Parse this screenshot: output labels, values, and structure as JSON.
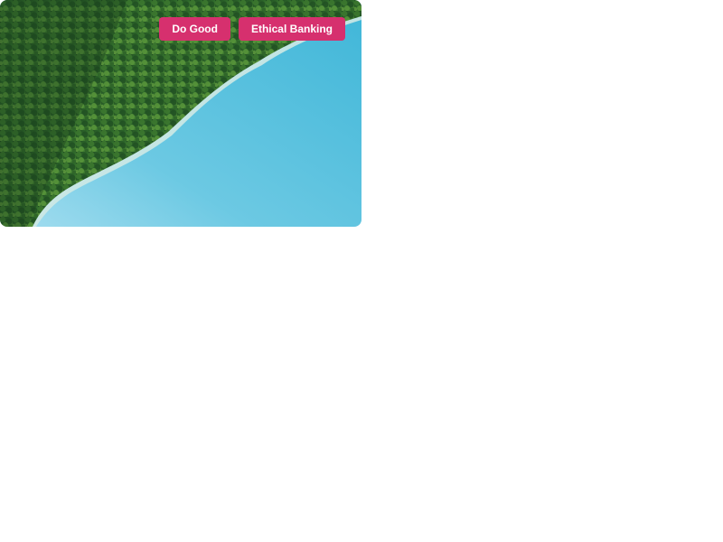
{
  "card": {
    "image_alt_subject": "forest-lake-aerial-photo",
    "tags": [
      {
        "label": "Do Good"
      },
      {
        "label": "Ethical Banking"
      }
    ]
  },
  "colors": {
    "tag_background": "#d6306e",
    "tag_text": "#ffffff",
    "forest_dark": "#1f4a22",
    "forest_light": "#5f9a3a",
    "water_light": "#9ad8ec",
    "water_main": "#4cbedc"
  }
}
